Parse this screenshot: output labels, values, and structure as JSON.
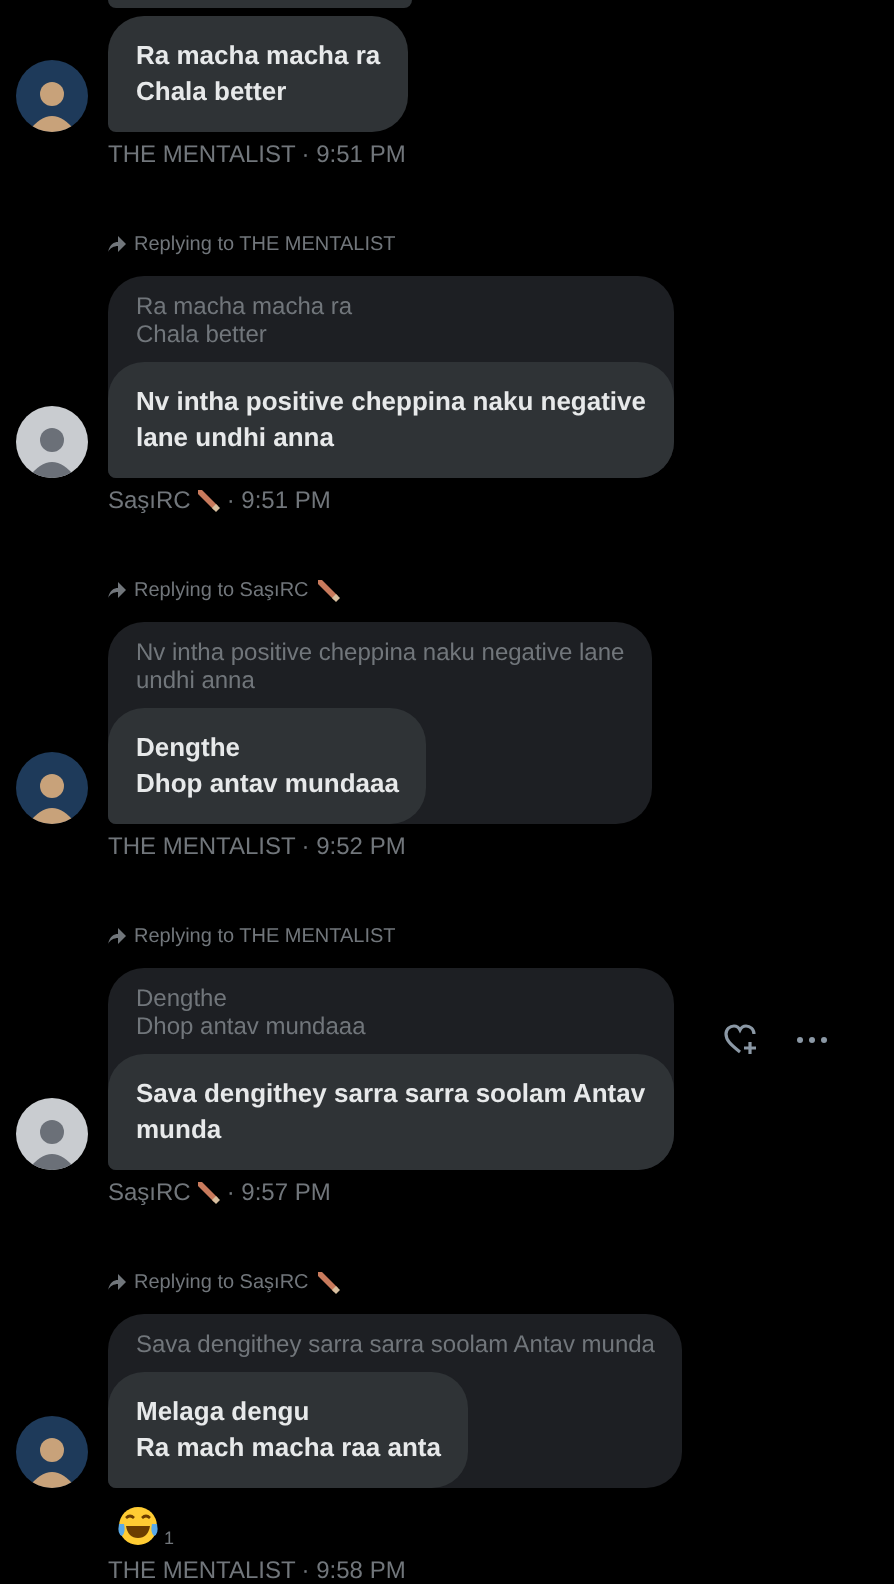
{
  "messages": [
    {
      "sender": "THE MENTALIST",
      "sender_badge": false,
      "time": "· 9:51 PM",
      "avatar": {
        "kind": "dark"
      },
      "lines": [
        "Ra macha macha ra",
        "Chala better"
      ]
    },
    {
      "reply": {
        "text": "Replying to THE MENTALIST",
        "badge": false
      },
      "quote": [
        "Ra macha macha ra",
        "Chala better"
      ],
      "sender": "SaşıRC",
      "sender_badge": true,
      "time": "· 9:51 PM",
      "avatar": {
        "kind": "light"
      },
      "lines": [
        "Nv intha positive cheppina naku negative",
        "lane undhi anna"
      ]
    },
    {
      "reply": {
        "text": "Replying to SaşıRC",
        "badge": true
      },
      "quote": [
        "Nv intha positive cheppina naku negative lane",
        "undhi anna"
      ],
      "sender": "THE MENTALIST",
      "sender_badge": false,
      "time": "· 9:52 PM",
      "avatar": {
        "kind": "dark"
      },
      "lines": [
        "Dengthe",
        "Dhop antav mundaaa"
      ]
    },
    {
      "reply": {
        "text": "Replying to THE MENTALIST",
        "badge": false
      },
      "quote": [
        "Dengthe",
        "Dhop antav mundaaa"
      ],
      "actions_visible": true,
      "sender": "SaşıRC",
      "sender_badge": true,
      "time": "· 9:57 PM",
      "avatar": {
        "kind": "light"
      },
      "lines": [
        "Sava dengithey sarra sarra soolam Antav",
        "munda"
      ]
    },
    {
      "reply": {
        "text": "Replying to SaşıRC",
        "badge": true
      },
      "quote": [
        "Sava dengithey sarra sarra soolam Antav munda"
      ],
      "sender": "THE MENTALIST",
      "sender_badge": false,
      "time": "· 9:58 PM",
      "avatar": {
        "kind": "dark"
      },
      "lines": [
        "Melaga dengu",
        "Ra mach macha raa anta"
      ],
      "reactions": [
        {
          "kind": "laugh",
          "count": "1"
        }
      ]
    }
  ]
}
